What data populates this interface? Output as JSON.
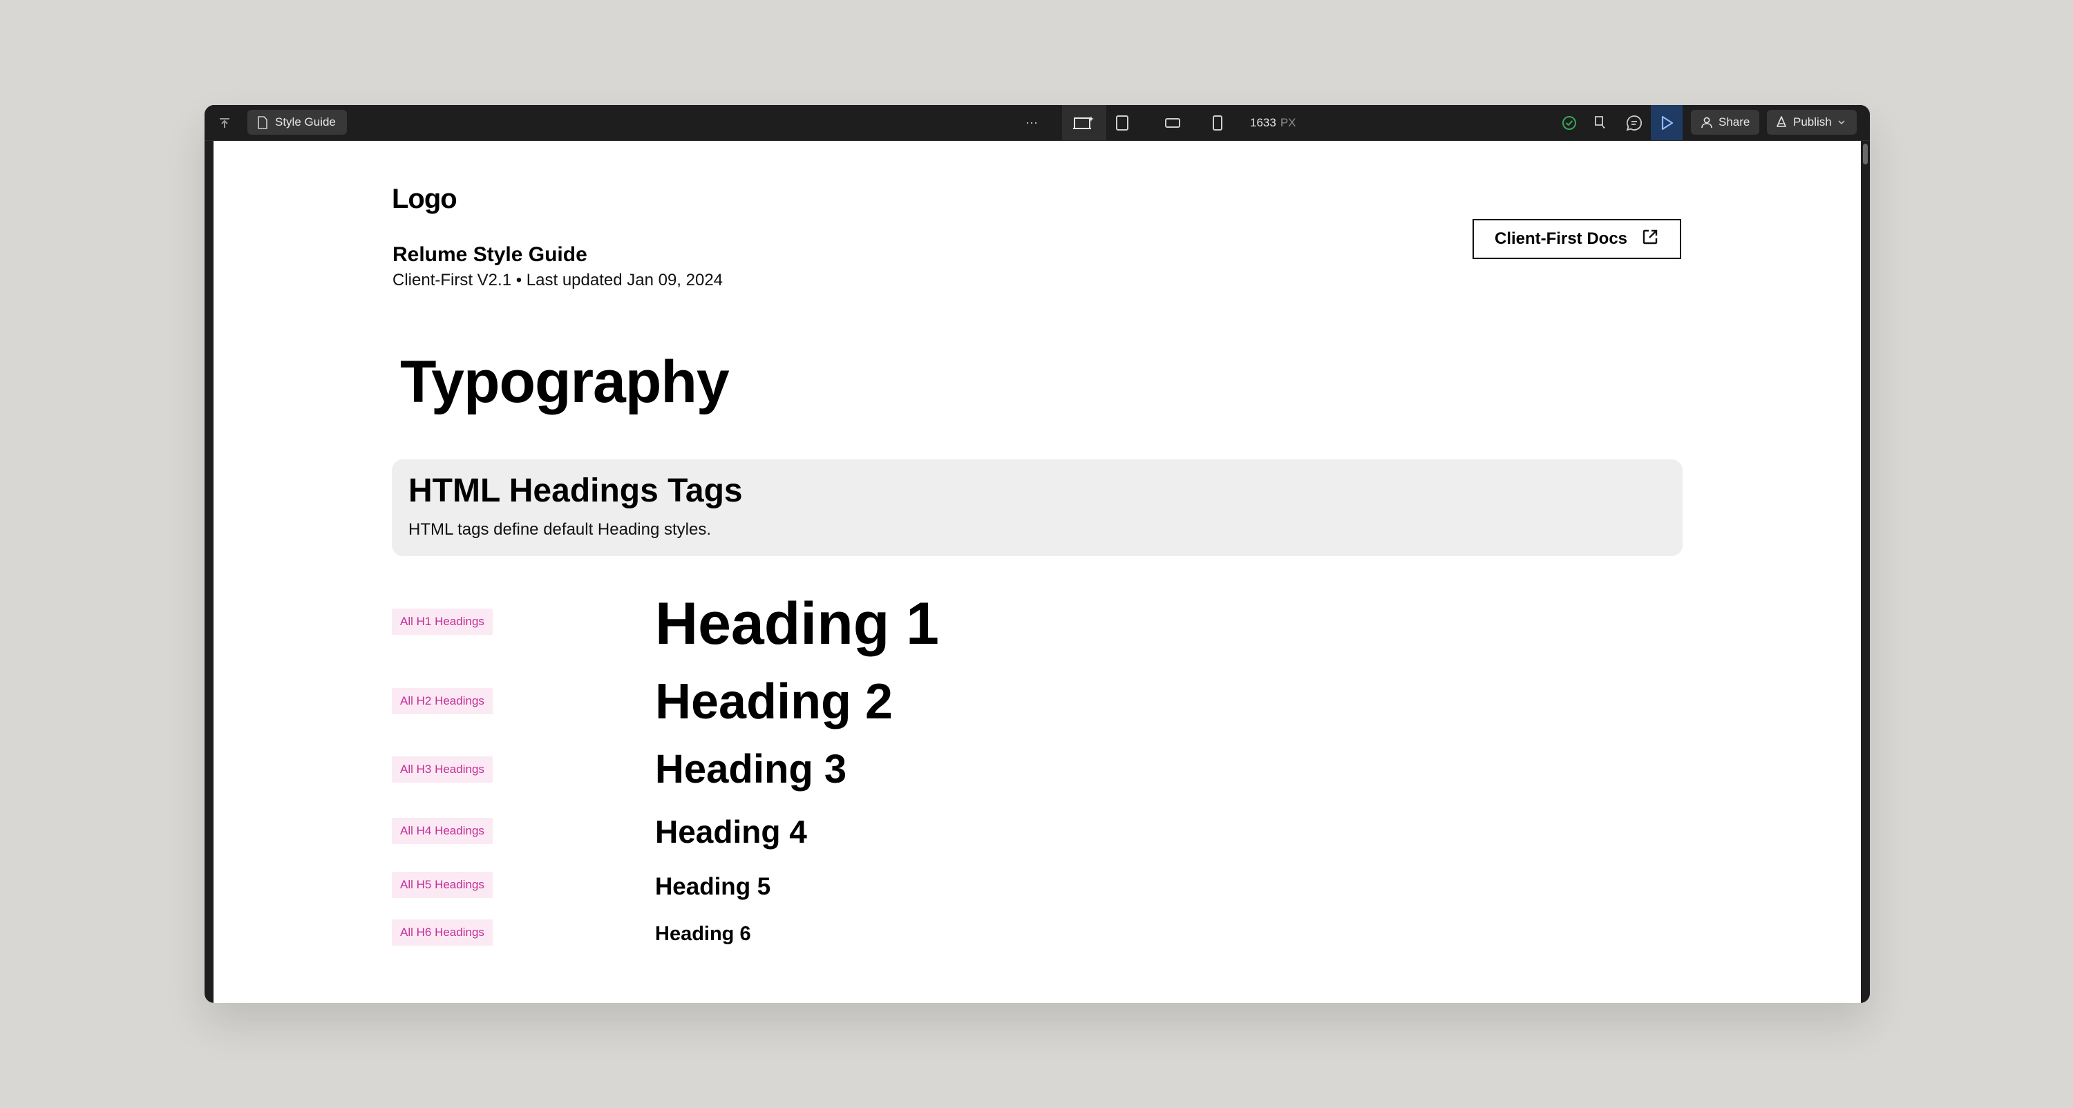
{
  "toolbar": {
    "page_name": "Style Guide",
    "more_label": "···",
    "width_value": "1633",
    "width_unit": "PX",
    "share_label": "Share",
    "publish_label": "Publish"
  },
  "colors": {
    "background": "#d8d7d3",
    "toolbar": "#1e1e1e",
    "preview_active": "#1f3a63",
    "tag_bg": "#fbe9f3",
    "tag_text": "#c22e98",
    "status_ok": "#3ba55c"
  },
  "icons": {
    "navigator": "arrow-up-to-line-icon",
    "page": "page-icon",
    "desktop": "desktop-breakpoint-icon",
    "tablet": "tablet-icon",
    "mobile_landscape": "mobile-landscape-icon",
    "mobile_portrait": "mobile-portrait-icon",
    "status": "check-circle-icon",
    "mode": "design-mode-icon",
    "comments": "comment-icon",
    "preview": "play-icon",
    "share": "user-icon",
    "publish": "rocket-icon",
    "docs_link": "external-link-icon"
  },
  "page": {
    "logo": "Logo",
    "title": "Relume Style Guide",
    "subtitle": "Client-First V2.1 • Last updated Jan 09, 2024",
    "docs_button": "Client-First Docs",
    "section_title": "Typography",
    "card": {
      "title": "HTML Headings Tags",
      "description": "HTML tags define default Heading styles."
    },
    "headings": [
      {
        "tag": "All H1 Headings",
        "text": "Heading 1"
      },
      {
        "tag": "All H2 Headings",
        "text": "Heading 2"
      },
      {
        "tag": "All H3 Headings",
        "text": "Heading 3"
      },
      {
        "tag": "All H4 Headings",
        "text": "Heading 4"
      },
      {
        "tag": "All H5 Headings",
        "text": "Heading 5"
      },
      {
        "tag": "All H6 Headings",
        "text": "Heading 6"
      }
    ]
  }
}
